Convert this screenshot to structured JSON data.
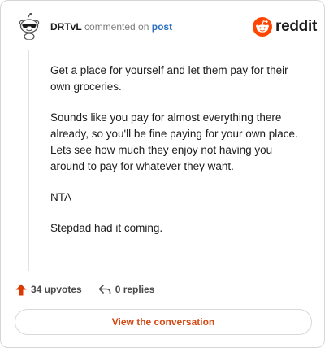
{
  "comment": {
    "username": "DRTvL",
    "commented_on_text": "commented on",
    "post_link_text": "post",
    "paragraphs": [
      "Get a place for yourself and let them pay for their own groceries.",
      "Sounds like you pay for almost everything there already, so you'll be fine paying for your own place.",
      "Lets see how much they enjoy not having you around to pay for whatever they want.",
      "NTA",
      "Stepdad had it coming."
    ]
  },
  "brand": {
    "wordmark": "reddit",
    "icon": "reddit-logo-icon",
    "color": "#ff4500"
  },
  "actions": {
    "upvotes_label": "34 upvotes",
    "upvote_icon": "upvote-arrow-icon",
    "upvote_color": "#d93a00",
    "replies_label": "0 replies",
    "reply_icon": "reply-arrow-icon"
  },
  "cta": {
    "label": "View the conversation",
    "color": "#d44a14"
  }
}
